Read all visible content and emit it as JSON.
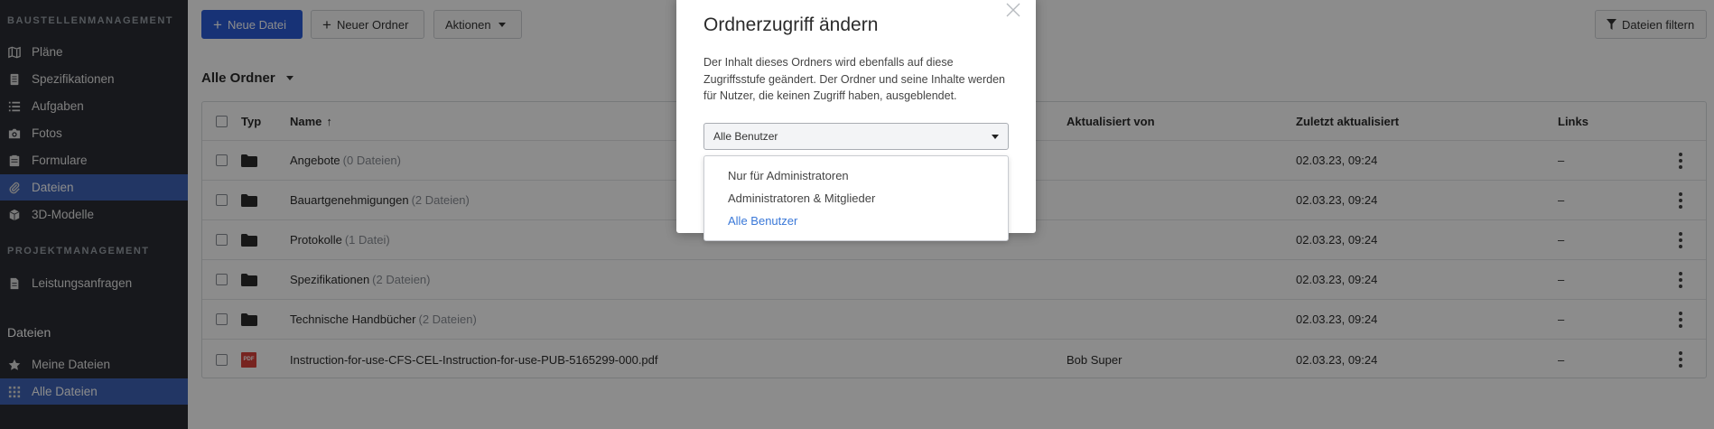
{
  "sidebar": {
    "section_construction": "BAUSTELLENMANAGEMENT",
    "items": [
      {
        "label": "Pläne",
        "icon": "map-icon"
      },
      {
        "label": "Spezifikationen",
        "icon": "book-icon"
      },
      {
        "label": "Aufgaben",
        "icon": "list-icon"
      },
      {
        "label": "Fotos",
        "icon": "camera-icon"
      },
      {
        "label": "Formulare",
        "icon": "clipboard-icon"
      },
      {
        "label": "Dateien",
        "icon": "paperclip-icon",
        "active": true
      },
      {
        "label": "3D-Modelle",
        "icon": "cube-icon"
      }
    ],
    "section_project": "PROJEKTMANAGEMENT",
    "project_items": [
      {
        "label": "Leistungsanfragen",
        "icon": "document-icon"
      }
    ],
    "files_heading": "Dateien",
    "files_items": [
      {
        "label": "Meine Dateien",
        "icon": "star-icon"
      },
      {
        "label": "Alle Dateien",
        "icon": "grid-icon",
        "active": true
      }
    ]
  },
  "toolbar": {
    "new_file": "Neue Datei",
    "new_folder": "Neuer Ordner",
    "actions": "Aktionen",
    "filter": "Dateien filtern"
  },
  "folder_selector": "Alle Ordner",
  "table": {
    "headers": {
      "type": "Typ",
      "name": "Name",
      "sort_indicator": "↑",
      "updated_by": "Aktualisiert von",
      "last_updated": "Zuletzt aktualisiert",
      "links": "Links"
    },
    "rows": [
      {
        "kind": "folder",
        "name": "Angebote",
        "count": "(0 Dateien)",
        "updated_by": "",
        "last_updated": "02.03.23, 09:24",
        "links": "–"
      },
      {
        "kind": "folder",
        "name": "Bauartgenehmigungen",
        "count": "(2 Dateien)",
        "updated_by": "",
        "last_updated": "02.03.23, 09:24",
        "links": "–"
      },
      {
        "kind": "folder",
        "name": "Protokolle",
        "count": "(1 Datei)",
        "updated_by": "",
        "last_updated": "02.03.23, 09:24",
        "links": "–"
      },
      {
        "kind": "folder",
        "name": "Spezifikationen",
        "count": "(2 Dateien)",
        "updated_by": "",
        "last_updated": "02.03.23, 09:24",
        "links": "–"
      },
      {
        "kind": "folder",
        "name": "Technische Handbücher",
        "count": "(2 Dateien)",
        "updated_by": "",
        "last_updated": "02.03.23, 09:24",
        "links": "–"
      },
      {
        "kind": "pdf",
        "icon_text": "PDF",
        "name": "Instruction-for-use-CFS-CEL-Instruction-for-use-PUB-5165299-000.pdf",
        "count": "",
        "updated_by": "Bob Super",
        "last_updated": "02.03.23, 09:24",
        "links": "–"
      }
    ]
  },
  "modal": {
    "title": "Ordnerzugriff ändern",
    "text": "Der Inhalt dieses Ordners wird ebenfalls auf diese Zugriffsstufe geändert. Der Ordner und seine Inhalte werden für Nutzer, die keinen Zugriff haben, ausgeblendet.",
    "select_value": "Alle Benutzer",
    "options": [
      "Nur für Administratoren",
      "Administratoren & Mitglieder",
      "Alle Benutzer"
    ],
    "selected_index": 2
  },
  "colors": {
    "sidebar_bg": "#2b2d33",
    "active_item": "#3e63b6",
    "primary": "#2a5bd7",
    "selected_option": "#3a78d8"
  }
}
